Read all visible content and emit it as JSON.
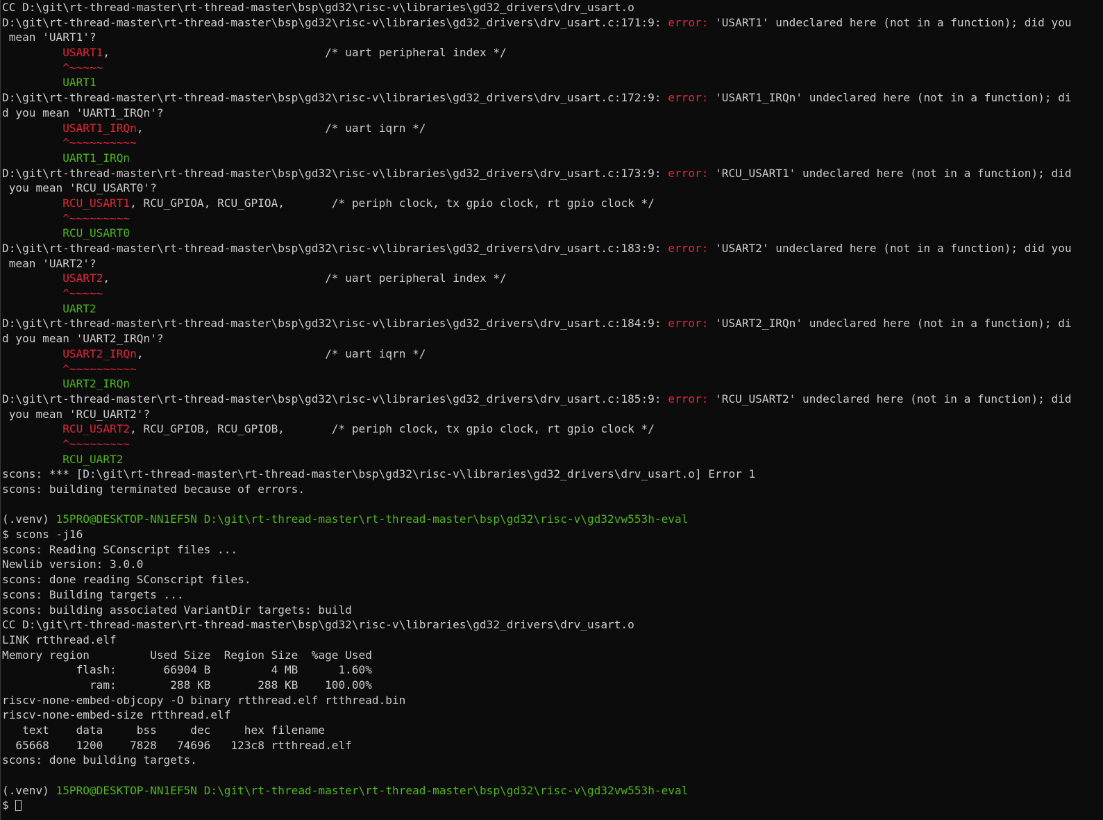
{
  "colors": {
    "background": "#0c0c0c",
    "text": "#cccccc",
    "error": "#e0283a",
    "hint": "#4fb51e",
    "prompt": "#4fb51e"
  },
  "lines": [
    [
      {
        "t": "CC D:\\git\\rt-thread-master\\rt-thread-master\\bsp\\gd32\\risc-v\\libraries\\gd32_drivers\\drv_usart.o",
        "c": "plain"
      }
    ],
    [
      {
        "t": "D:\\git\\rt-thread-master\\rt-thread-master\\bsp\\gd32\\risc-v\\libraries\\gd32_drivers\\drv_usart.c:171:9: ",
        "c": "plain"
      },
      {
        "t": "error:",
        "c": "red"
      },
      {
        "t": " 'USART1' undeclared here (not in a function); did you",
        "c": "plain"
      }
    ],
    [
      {
        "t": " mean 'UART1'?",
        "c": "plain"
      }
    ],
    [
      {
        "t": "         ",
        "c": "plain"
      },
      {
        "t": "USART1",
        "c": "red"
      },
      {
        "t": ",                                /* uart peripheral index */",
        "c": "plain"
      }
    ],
    [
      {
        "t": "         ",
        "c": "plain"
      },
      {
        "t": "^~~~~~",
        "c": "red"
      }
    ],
    [
      {
        "t": "         ",
        "c": "plain"
      },
      {
        "t": "UART1",
        "c": "green"
      }
    ],
    [
      {
        "t": "D:\\git\\rt-thread-master\\rt-thread-master\\bsp\\gd32\\risc-v\\libraries\\gd32_drivers\\drv_usart.c:172:9: ",
        "c": "plain"
      },
      {
        "t": "error:",
        "c": "red"
      },
      {
        "t": " 'USART1_IRQn' undeclared here (not in a function); di",
        "c": "plain"
      }
    ],
    [
      {
        "t": "d you mean 'UART1_IRQn'?",
        "c": "plain"
      }
    ],
    [
      {
        "t": "         ",
        "c": "plain"
      },
      {
        "t": "USART1_IRQn",
        "c": "red"
      },
      {
        "t": ",                           /* uart iqrn */",
        "c": "plain"
      }
    ],
    [
      {
        "t": "         ",
        "c": "plain"
      },
      {
        "t": "^~~~~~~~~~~",
        "c": "red"
      }
    ],
    [
      {
        "t": "         ",
        "c": "plain"
      },
      {
        "t": "UART1_IRQn",
        "c": "green"
      }
    ],
    [
      {
        "t": "D:\\git\\rt-thread-master\\rt-thread-master\\bsp\\gd32\\risc-v\\libraries\\gd32_drivers\\drv_usart.c:173:9: ",
        "c": "plain"
      },
      {
        "t": "error:",
        "c": "red"
      },
      {
        "t": " 'RCU_USART1' undeclared here (not in a function); did",
        "c": "plain"
      }
    ],
    [
      {
        "t": " you mean 'RCU_USART0'?",
        "c": "plain"
      }
    ],
    [
      {
        "t": "         ",
        "c": "plain"
      },
      {
        "t": "RCU_USART1",
        "c": "red"
      },
      {
        "t": ", RCU_GPIOA, RCU_GPIOA,       /* periph clock, tx gpio clock, rt gpio clock */",
        "c": "plain"
      }
    ],
    [
      {
        "t": "         ",
        "c": "plain"
      },
      {
        "t": "^~~~~~~~~~",
        "c": "red"
      }
    ],
    [
      {
        "t": "         ",
        "c": "plain"
      },
      {
        "t": "RCU_USART0",
        "c": "green"
      }
    ],
    [
      {
        "t": "D:\\git\\rt-thread-master\\rt-thread-master\\bsp\\gd32\\risc-v\\libraries\\gd32_drivers\\drv_usart.c:183:9: ",
        "c": "plain"
      },
      {
        "t": "error:",
        "c": "red"
      },
      {
        "t": " 'USART2' undeclared here (not in a function); did you",
        "c": "plain"
      }
    ],
    [
      {
        "t": " mean 'UART2'?",
        "c": "plain"
      }
    ],
    [
      {
        "t": "         ",
        "c": "plain"
      },
      {
        "t": "USART2",
        "c": "red"
      },
      {
        "t": ",                                /* uart peripheral index */",
        "c": "plain"
      }
    ],
    [
      {
        "t": "         ",
        "c": "plain"
      },
      {
        "t": "^~~~~~",
        "c": "red"
      }
    ],
    [
      {
        "t": "         ",
        "c": "plain"
      },
      {
        "t": "UART2",
        "c": "green"
      }
    ],
    [
      {
        "t": "D:\\git\\rt-thread-master\\rt-thread-master\\bsp\\gd32\\risc-v\\libraries\\gd32_drivers\\drv_usart.c:184:9: ",
        "c": "plain"
      },
      {
        "t": "error:",
        "c": "red"
      },
      {
        "t": " 'USART2_IRQn' undeclared here (not in a function); di",
        "c": "plain"
      }
    ],
    [
      {
        "t": "d you mean 'UART2_IRQn'?",
        "c": "plain"
      }
    ],
    [
      {
        "t": "         ",
        "c": "plain"
      },
      {
        "t": "USART2_IRQn",
        "c": "red"
      },
      {
        "t": ",                           /* uart iqrn */",
        "c": "plain"
      }
    ],
    [
      {
        "t": "         ",
        "c": "plain"
      },
      {
        "t": "^~~~~~~~~~~",
        "c": "red"
      }
    ],
    [
      {
        "t": "         ",
        "c": "plain"
      },
      {
        "t": "UART2_IRQn",
        "c": "green"
      }
    ],
    [
      {
        "t": "D:\\git\\rt-thread-master\\rt-thread-master\\bsp\\gd32\\risc-v\\libraries\\gd32_drivers\\drv_usart.c:185:9: ",
        "c": "plain"
      },
      {
        "t": "error:",
        "c": "red"
      },
      {
        "t": " 'RCU_USART2' undeclared here (not in a function); did",
        "c": "plain"
      }
    ],
    [
      {
        "t": " you mean 'RCU_UART2'?",
        "c": "plain"
      }
    ],
    [
      {
        "t": "         ",
        "c": "plain"
      },
      {
        "t": "RCU_USART2",
        "c": "red"
      },
      {
        "t": ", RCU_GPIOB, RCU_GPIOB,       /* periph clock, tx gpio clock, rt gpio clock */",
        "c": "plain"
      }
    ],
    [
      {
        "t": "         ",
        "c": "plain"
      },
      {
        "t": "^~~~~~~~~~",
        "c": "red"
      }
    ],
    [
      {
        "t": "         ",
        "c": "plain"
      },
      {
        "t": "RCU_UART2",
        "c": "green"
      }
    ],
    [
      {
        "t": "scons: *** [D:\\git\\rt-thread-master\\rt-thread-master\\bsp\\gd32\\risc-v\\libraries\\gd32_drivers\\drv_usart.o] Error 1",
        "c": "plain"
      }
    ],
    [
      {
        "t": "scons: building terminated because of errors.",
        "c": "plain"
      }
    ],
    [
      {
        "t": "",
        "c": "plain"
      }
    ],
    [
      {
        "t": "(.venv) ",
        "c": "plain"
      },
      {
        "t": "15PRO@DESKTOP-NN1EF5N",
        "c": "green"
      },
      {
        "t": " ",
        "c": "plain"
      },
      {
        "t": "D:\\git\\rt-thread-master\\rt-thread-master\\bsp\\gd32\\risc-v\\gd32vw553h-eval",
        "c": "green"
      }
    ],
    [
      {
        "t": "$ scons -j16",
        "c": "plain"
      }
    ],
    [
      {
        "t": "scons: Reading SConscript files ...",
        "c": "plain"
      }
    ],
    [
      {
        "t": "Newlib version: 3.0.0",
        "c": "plain"
      }
    ],
    [
      {
        "t": "scons: done reading SConscript files.",
        "c": "plain"
      }
    ],
    [
      {
        "t": "scons: Building targets ...",
        "c": "plain"
      }
    ],
    [
      {
        "t": "scons: building associated VariantDir targets: build",
        "c": "plain"
      }
    ],
    [
      {
        "t": "CC D:\\git\\rt-thread-master\\rt-thread-master\\bsp\\gd32\\risc-v\\libraries\\gd32_drivers\\drv_usart.o",
        "c": "plain"
      }
    ],
    [
      {
        "t": "LINK rtthread.elf",
        "c": "plain"
      }
    ],
    [
      {
        "t": "Memory region         Used Size  Region Size  %age Used",
        "c": "plain"
      }
    ],
    [
      {
        "t": "           flash:       66904 B         4 MB      1.60%",
        "c": "plain"
      }
    ],
    [
      {
        "t": "             ram:        288 KB       288 KB    100.00%",
        "c": "plain"
      }
    ],
    [
      {
        "t": "riscv-none-embed-objcopy -O binary rtthread.elf rtthread.bin",
        "c": "plain"
      }
    ],
    [
      {
        "t": "riscv-none-embed-size rtthread.elf",
        "c": "plain"
      }
    ],
    [
      {
        "t": "   text    data     bss     dec     hex filename",
        "c": "plain"
      }
    ],
    [
      {
        "t": "  65668    1200    7828   74696   123c8 rtthread.elf",
        "c": "plain"
      }
    ],
    [
      {
        "t": "scons: done building targets.",
        "c": "plain"
      }
    ],
    [
      {
        "t": "",
        "c": "plain"
      }
    ],
    [
      {
        "t": "(.venv) ",
        "c": "plain"
      },
      {
        "t": "15PRO@DESKTOP-NN1EF5N",
        "c": "green"
      },
      {
        "t": " ",
        "c": "plain"
      },
      {
        "t": "D:\\git\\rt-thread-master\\rt-thread-master\\bsp\\gd32\\risc-v\\gd32vw553h-eval",
        "c": "green"
      }
    ],
    [
      {
        "t": "$ ",
        "c": "plain"
      }
    ]
  ]
}
